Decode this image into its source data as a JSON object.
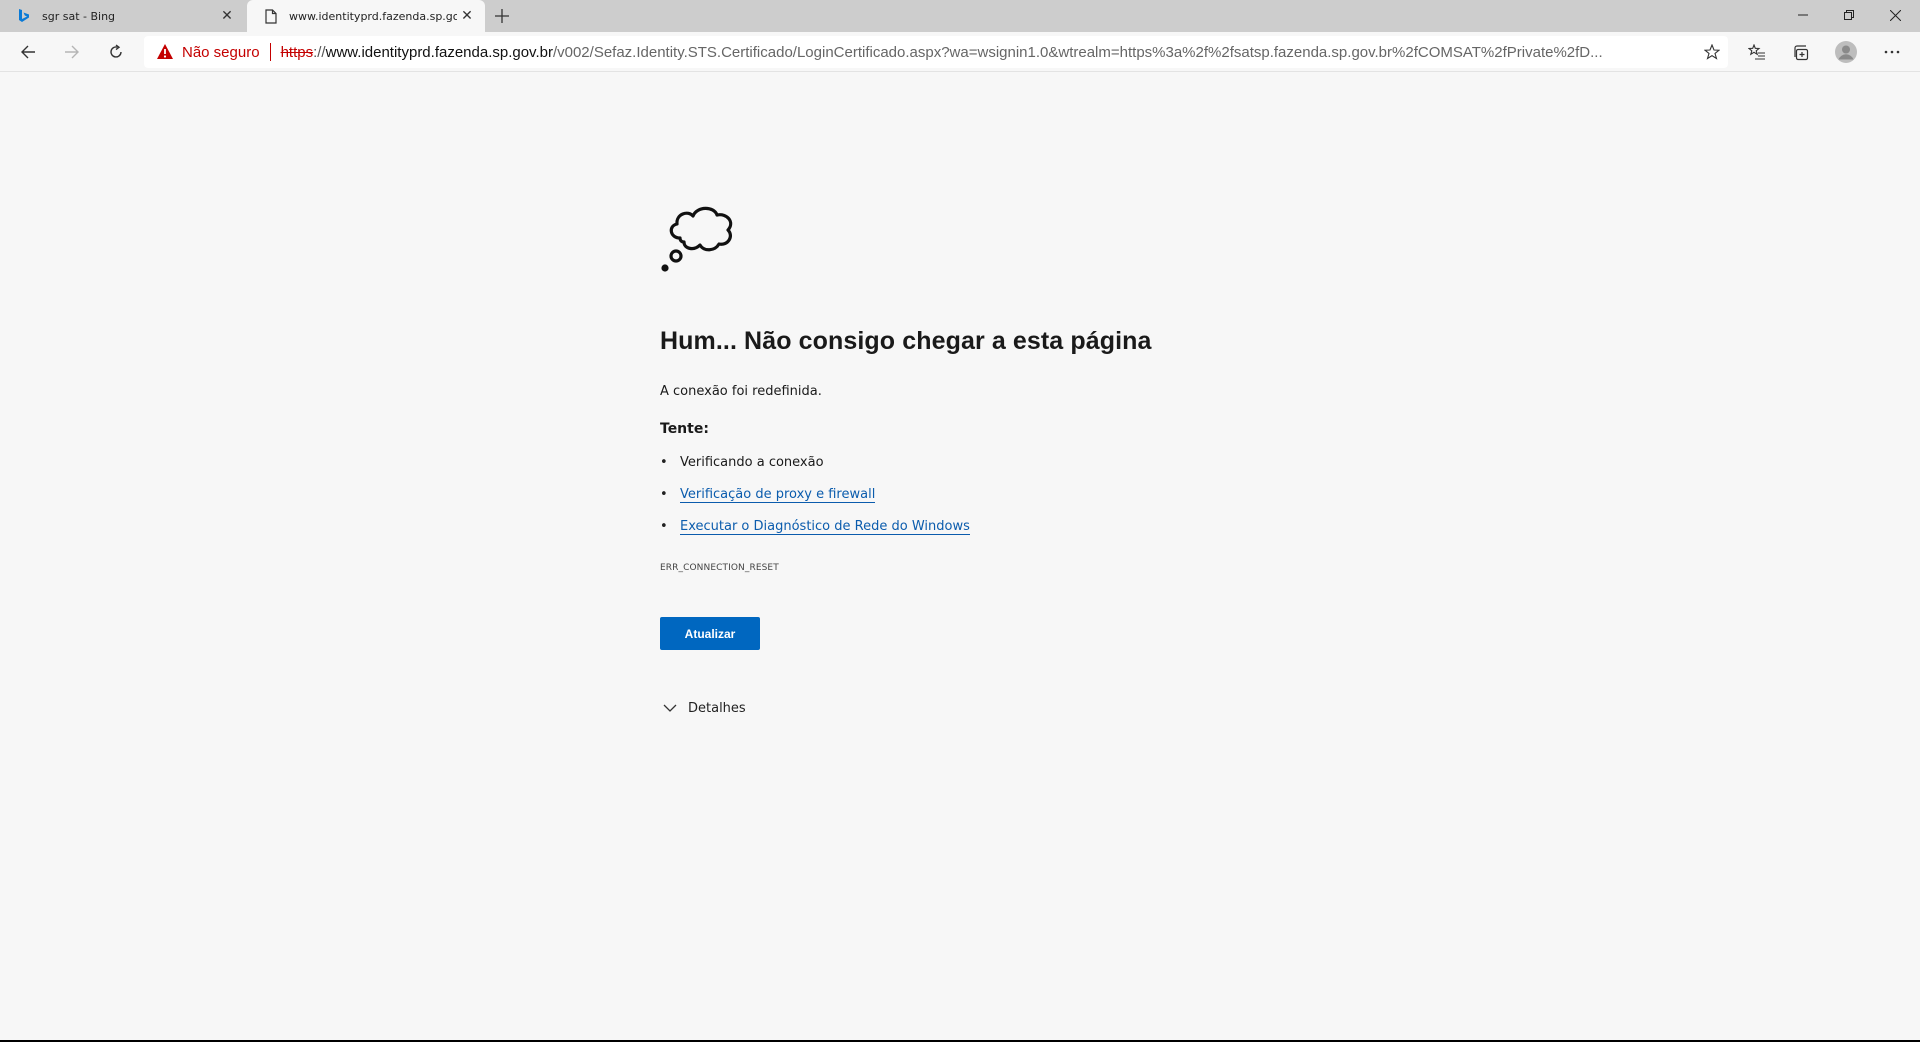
{
  "tabs": [
    {
      "title": "sgr sat - Bing",
      "favicon": "bing-icon",
      "active": false
    },
    {
      "title": "www.identityprd.fazenda.sp.gov.b",
      "favicon": "page-icon",
      "active": true
    }
  ],
  "window_controls": [
    "minimize-icon",
    "restore-icon",
    "close-icon"
  ],
  "toolbar": {
    "security_label": "Não seguro",
    "url": {
      "scheme": "https",
      "separator": "://",
      "host": "www.identityprd.fazenda.sp.gov.br",
      "path": "/v002/Sefaz.Identity.STS.Certificado/LoginCertificado.aspx?wa=wsignin1.0&wtrealm=https%3a%2f%2fsatsp.fazenda.sp.gov.br%2fCOMSAT%2fPrivate%2fD..."
    }
  },
  "error_page": {
    "title": "Hum... Não consigo chegar a esta página",
    "description": "A conexão foi redefinida.",
    "try_label": "Tente:",
    "suggestions": [
      {
        "text": "Verificando a conexão",
        "link": false
      },
      {
        "text": "Verificação de proxy e firewall",
        "link": true
      },
      {
        "text": "Executar o Diagnóstico de Rede do Windows",
        "link": true
      }
    ],
    "error_code": "ERR_CONNECTION_RESET",
    "refresh_label": "Atualizar",
    "details_label": "Detalhes"
  },
  "colors": {
    "accent": "#0067c0",
    "link": "#0b5cad",
    "warning": "#c40000",
    "background": "#f7f7f7",
    "tabstrip": "#cdcdcd"
  }
}
